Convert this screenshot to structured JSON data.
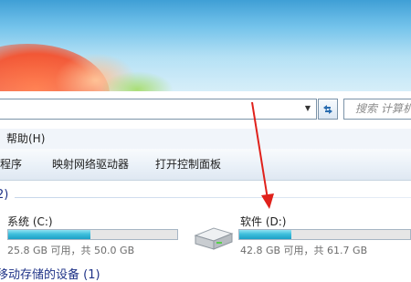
{
  "address_bar": {
    "value": "",
    "search_placeholder": "搜索 计算机"
  },
  "menu": {
    "items": [
      {
        "label": "帮助(H)"
      }
    ]
  },
  "command_bar": {
    "items": [
      {
        "label": "程序"
      },
      {
        "label": "映射网络驱动器"
      },
      {
        "label": "打开控制面板"
      }
    ]
  },
  "content": {
    "group_hard_drives": {
      "header": "2)"
    },
    "drives": [
      {
        "name": "系统 (C:)",
        "free": "25.8 GB 可用，共 50.0 GB",
        "used_fraction": 0.484
      },
      {
        "name": "软件 (D:)",
        "free": "42.8 GB 可用，共 61.7 GB",
        "used_fraction": 0.306
      }
    ],
    "group_removable": {
      "header": "移动存储的设备 (1)"
    }
  },
  "annotation": {
    "arrow_color": "#e0211b"
  }
}
